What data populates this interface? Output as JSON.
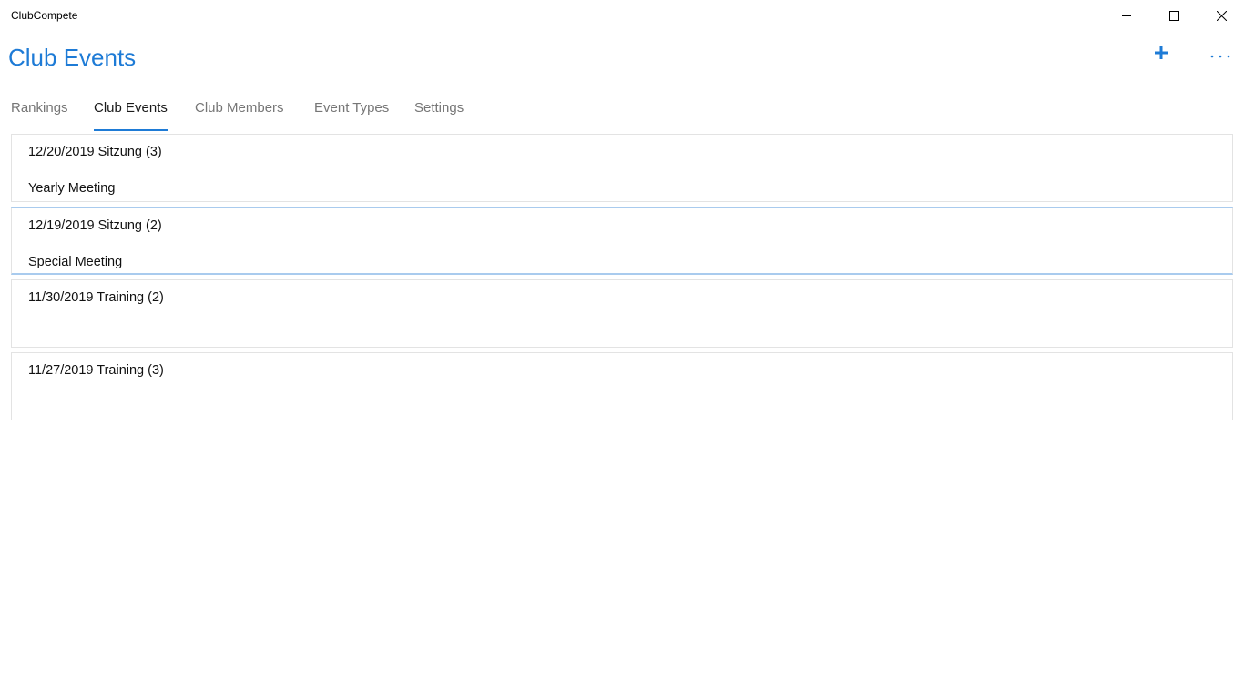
{
  "window": {
    "app_title": "ClubCompete",
    "controls": {
      "minimize_icon": "minimize-icon",
      "maximize_icon": "maximize-icon",
      "close_icon": "close-icon"
    }
  },
  "header": {
    "title": "Club Events",
    "accent_color": "#1e7bd6",
    "commands": {
      "add_icon": "plus-icon",
      "more_icon": "more-icon"
    }
  },
  "tabs": [
    {
      "label": "Rankings",
      "active": false
    },
    {
      "label": "Club Events",
      "active": true
    },
    {
      "label": "Club Members",
      "active": false
    },
    {
      "label": "Event Types",
      "active": false
    },
    {
      "label": "Settings",
      "active": false
    }
  ],
  "events": [
    {
      "heading": "12/20/2019 Sitzung (3)",
      "description": "Yearly Meeting",
      "selected": false
    },
    {
      "heading": "12/19/2019 Sitzung (2)",
      "description": "Special Meeting",
      "selected": true
    },
    {
      "heading": "11/30/2019 Training (2)",
      "description": "",
      "selected": false
    },
    {
      "heading": "11/27/2019 Training (3)",
      "description": "",
      "selected": false
    }
  ]
}
